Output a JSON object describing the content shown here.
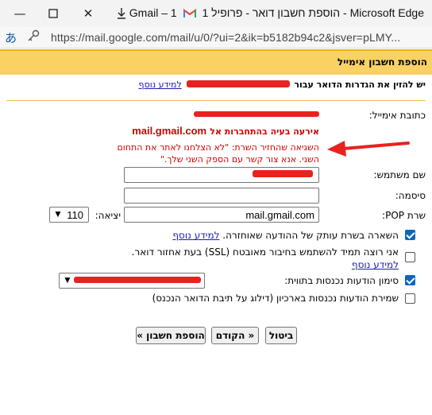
{
  "window": {
    "title_prefix": "Gmail – 1 ",
    "title_main": "הוספת חשבון דואר - פרופיל 1 - Microsoft Edge",
    "icons": [
      "minimize-icon",
      "maximize-icon",
      "download-icon",
      "gmail-icon"
    ]
  },
  "address_bar": {
    "url": "https://mail.google.com/mail/u/0/?ui=2&ik=b5182b94c2&jsver=pLMY..."
  },
  "header": {
    "title": "הוספת חשבון אימייל"
  },
  "intro": {
    "text": "יש להזין את הגדרות הדואר עבור",
    "learn_more": "למידע נוסף"
  },
  "form": {
    "email_label": "כתובת אימייל:",
    "error_title": "אירעה בעיה בהתחברות אל",
    "error_host": "mail.gmail.com",
    "error_message": "השגיאה שהחזיר השרת: \"לא הצלחנו לאתר את התחום השני. אנא צור קשר עם הספק השני שלך.\"",
    "username_label": "שם משתמש:",
    "password_label": "סיסמה:",
    "pop_label": "שרת POP:",
    "pop_value": "mail.gmail.com",
    "port_label": "יציאה:",
    "port_value": "110"
  },
  "options": [
    {
      "text": "השארה בשרת עותק של ההודעה שאוחזרה.",
      "link": "למידע נוסף",
      "checked": true
    },
    {
      "text": "אני רוצה תמיד להשתמש בחיבור מאובטח (SSL) בעת אחזור דואר.",
      "link": "למידע נוסף",
      "checked": false
    },
    {
      "text": "סימון הודעות נכנסות בתווית:",
      "checked": true
    },
    {
      "text": "שמירת הודעות נכנסות בארכיון (דילוג על תיבת הדואר הנכנס)",
      "checked": false
    }
  ],
  "buttons": {
    "cancel": "ביטול",
    "back": "« הקודם",
    "add": "הוספת חשבון »"
  },
  "colors": {
    "header_bg": "#fad163",
    "error": "#d00000",
    "redaction": "#e8221f",
    "checkbox": "#0a66c2"
  }
}
